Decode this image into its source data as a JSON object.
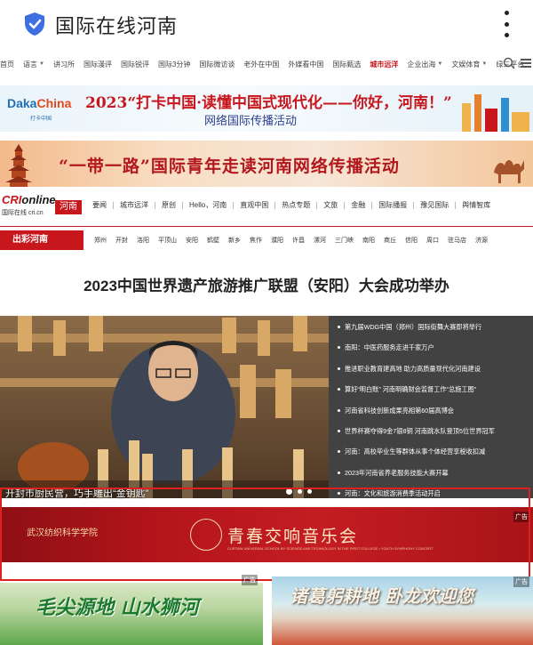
{
  "app": {
    "title": "国际在线河南"
  },
  "nav": {
    "items": [
      {
        "label": "首页",
        "caret": false,
        "active": false
      },
      {
        "label": "语言",
        "caret": true,
        "active": false
      },
      {
        "label": "讲习所",
        "caret": false,
        "active": false
      },
      {
        "label": "国际漫评",
        "caret": false,
        "active": false
      },
      {
        "label": "国际锐评",
        "caret": false,
        "active": false
      },
      {
        "label": "国际3分钟",
        "caret": false,
        "active": false
      },
      {
        "label": "国际微访谈",
        "caret": false,
        "active": false
      },
      {
        "label": "老外在中国",
        "caret": false,
        "active": false
      },
      {
        "label": "外媒看中国",
        "caret": false,
        "active": false
      },
      {
        "label": "国际甄选",
        "caret": false,
        "active": false
      },
      {
        "label": "城市远洋",
        "caret": false,
        "active": true
      },
      {
        "label": "企业出海",
        "caret": true,
        "active": false
      },
      {
        "label": "文娱体育",
        "caret": true,
        "active": false
      },
      {
        "label": "绿三平台",
        "caret": false,
        "active": false
      }
    ]
  },
  "banner1": {
    "logo_main": "Daka",
    "logo_accent": "China",
    "logo_sub": "打卡中国",
    "line1": "2023“打卡中国·读懂中国式现代化——你好，河南！”",
    "line2": "网络国际传播活动"
  },
  "banner2": {
    "text": "“一带一路”国际青年走读河南网络传播活动"
  },
  "cri": {
    "logo_cri": "CRI",
    "logo_online": "online",
    "logo_sub": "国际在线 cri.cn",
    "henan": "河南"
  },
  "channels": [
    "要闻",
    "城市远洋",
    "原创",
    "Hello，河南",
    "直观中国",
    "热点专题",
    "文旅",
    "金融",
    "国际播报",
    "豫见国际",
    "舆情智库"
  ],
  "citybar": {
    "label": "出彩河南",
    "cities": [
      "郑州",
      "开封",
      "洛阳",
      "平顶山",
      "安阳",
      "鹤壁",
      "新乡",
      "焦作",
      "濮阳",
      "许昌",
      "漯河",
      "三门峡",
      "南阳",
      "商丘",
      "信阳",
      "周口",
      "驻马店",
      "济源"
    ]
  },
  "headline": "2023中国世界遗产旅游推广联盟（安阳）大会成功举办",
  "hero": {
    "caption": "开封市厨民营，巧手雕出“金钥匙”"
  },
  "news": [
    "第九届WDG中国（郑州）国际街舞大赛即将举行",
    "南阳：中医药服务走进千家万户",
    "推进职业教育建高地 助力高质量现代化河南建设",
    "算好“明白账” 河南明确财会监督工作“总施工图”",
    "河南省科技创新成果亮相第60届高博会",
    "世界杯赛夺得9金7银8铜 河南跳水队登顶5位世界冠军",
    "河南：高校毕业生等群体从事个体经营享税收扣减",
    "2023年河南省养老服务技能大赛开幕",
    "河南：文化和旅游消费季活动开启"
  ],
  "ad": {
    "school": "武汉纺织科学学院",
    "concert": "青春交响音乐会",
    "english": "CURTAIN UNIVERSAL SCHOOL BY SCIENCE AND TECHNOLOGY IN THE FIRST COLLEGE • YOUTH SYMPHONY CONCERT",
    "tag": "广告"
  },
  "bottom": {
    "left_title": "毛尖源地 山水狮河",
    "right_title": "诸葛躬耕地 卧龙欢迎您",
    "tag": "广告"
  },
  "colors": {
    "brand_red": "#c8161d",
    "news_bg": "#424242",
    "highlight_border": "#e02020",
    "shield_blue": "#3d6fe0"
  }
}
